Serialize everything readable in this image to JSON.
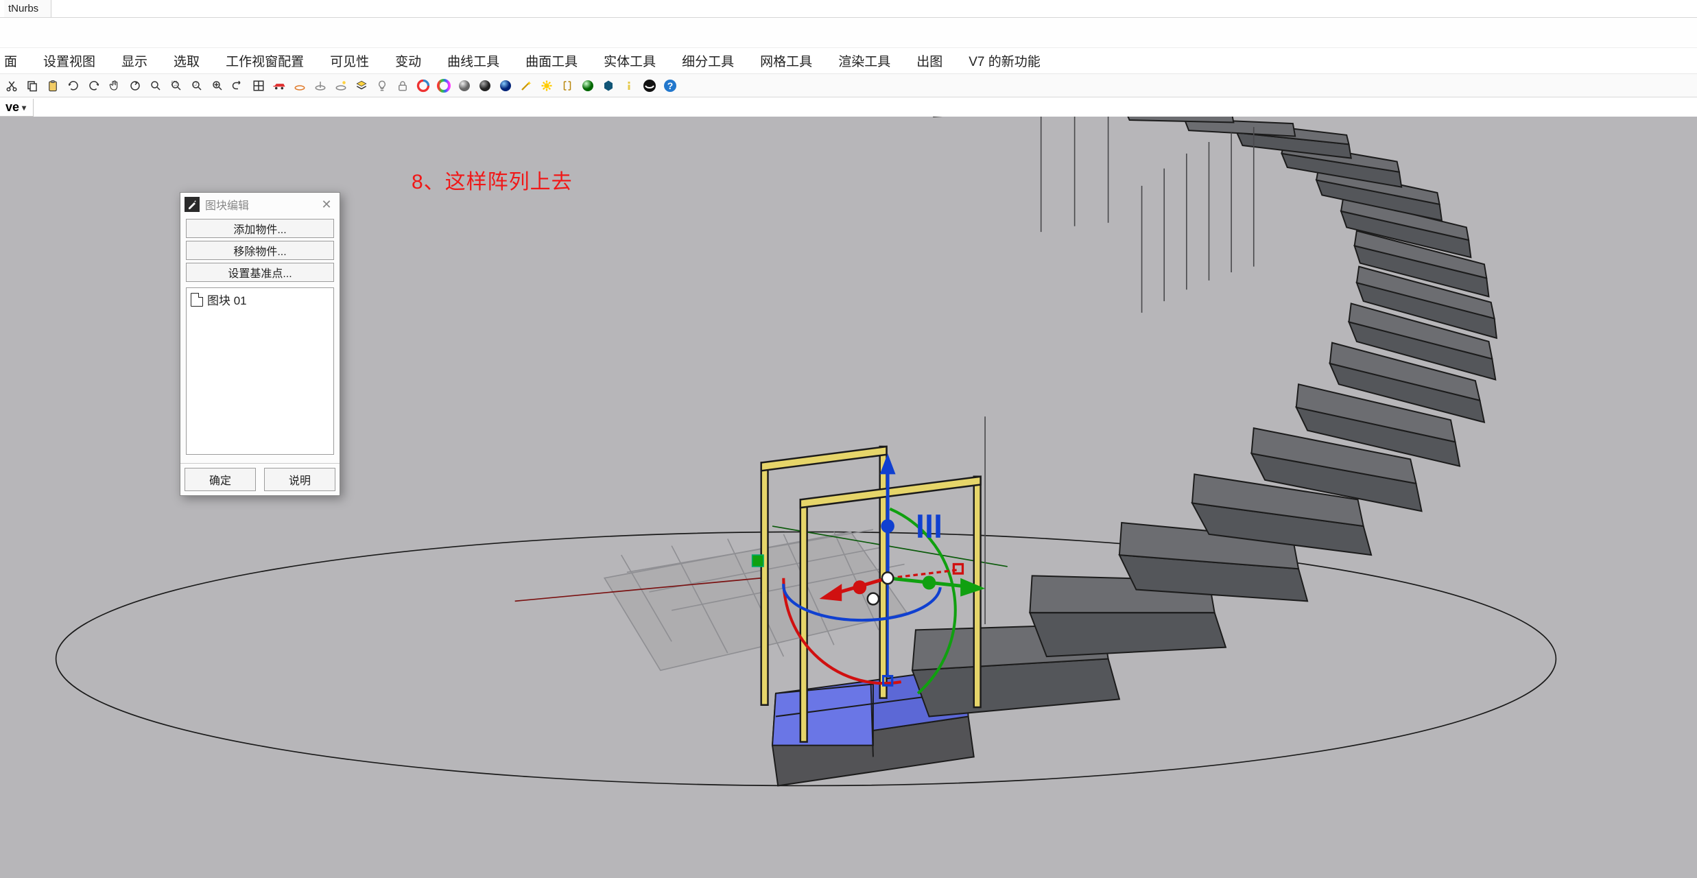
{
  "title_fragment": "tNurbs",
  "menus": {
    "m0": "面",
    "m1": "设置视图",
    "m2": "显示",
    "m3": "选取",
    "m4": "工作视窗配置",
    "m5": "可见性",
    "m6": "变动",
    "m7": "曲线工具",
    "m8": "曲面工具",
    "m9": "实体工具",
    "m10": "细分工具",
    "m11": "网格工具",
    "m12": "渲染工具",
    "m13": "出图",
    "m14": "V7 的新功能"
  },
  "viewport_label": "ve",
  "annotation": "8、这样阵列上去",
  "dialog": {
    "title": "图块编辑",
    "add": "添加物件...",
    "remove": "移除物件...",
    "setbase": "设置基准点...",
    "item0": "图块 01",
    "ok": "确定",
    "help": "说明"
  },
  "colors": {
    "viewport_bg": "#b7b6b9",
    "annotation": "#f01818",
    "step_face": "#6c6d71",
    "step_edge": "#1b1b1b",
    "selected_face": "#5c68d6",
    "rail": "#e6d56a"
  }
}
